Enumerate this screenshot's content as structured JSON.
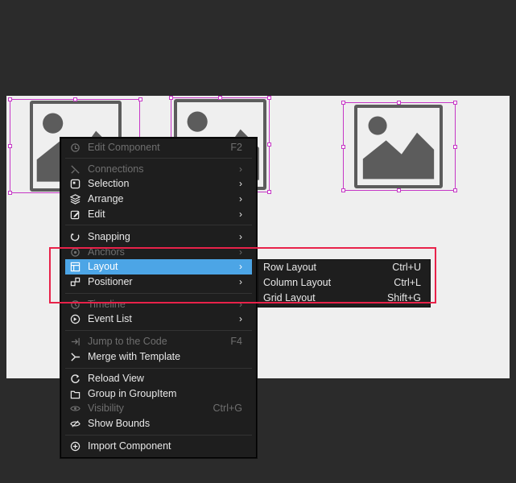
{
  "menu": {
    "items": [
      {
        "label": "Edit Component",
        "shortcut": "F2",
        "icon": "edit-component-icon",
        "disabled": true
      },
      {
        "label": "Connections",
        "icon": "connections-icon",
        "disabled": true,
        "submenu": true
      },
      {
        "label": "Selection",
        "icon": "selection-icon",
        "submenu": true
      },
      {
        "label": "Arrange",
        "icon": "arrange-icon",
        "submenu": true
      },
      {
        "label": "Edit",
        "icon": "edit-icon",
        "submenu": true
      },
      {
        "label": "Snapping",
        "icon": "snapping-icon",
        "submenu": true
      },
      {
        "label": "Anchors",
        "icon": "anchors-icon",
        "disabled": true,
        "submenu": true
      },
      {
        "label": "Layout",
        "icon": "layout-icon",
        "submenu": true,
        "active": true
      },
      {
        "label": "Positioner",
        "icon": "positioner-icon",
        "submenu": true
      },
      {
        "label": "Timeline",
        "icon": "timeline-icon",
        "disabled": true,
        "submenu": true
      },
      {
        "label": "Event List",
        "icon": "event-list-icon",
        "submenu": true
      },
      {
        "label": "Jump to the Code",
        "shortcut": "F4",
        "icon": "jump-to-code-icon",
        "disabled": true
      },
      {
        "label": "Merge with Template",
        "icon": "merge-icon"
      },
      {
        "label": "Reload View",
        "icon": "reload-icon"
      },
      {
        "label": "Group in GroupItem",
        "icon": "group-icon"
      },
      {
        "label": "Visibility",
        "shortcut": "Ctrl+G",
        "icon": "visibility-icon",
        "disabled": true
      },
      {
        "label": "Show Bounds",
        "icon": "show-bounds-icon"
      },
      {
        "label": "Import Component",
        "icon": "import-icon"
      }
    ],
    "arrow": "›"
  },
  "submenu": {
    "items": [
      {
        "label": "Row Layout",
        "shortcut": "Ctrl+U"
      },
      {
        "label": "Column Layout",
        "shortcut": "Ctrl+L"
      },
      {
        "label": "Grid Layout",
        "shortcut": "Shift+G"
      }
    ]
  },
  "colors": {
    "background": "#2b2b2b",
    "canvas": "#efefef",
    "selection": "#c637c6",
    "active": "#4ca5e6",
    "highlight": "#e8224a"
  }
}
